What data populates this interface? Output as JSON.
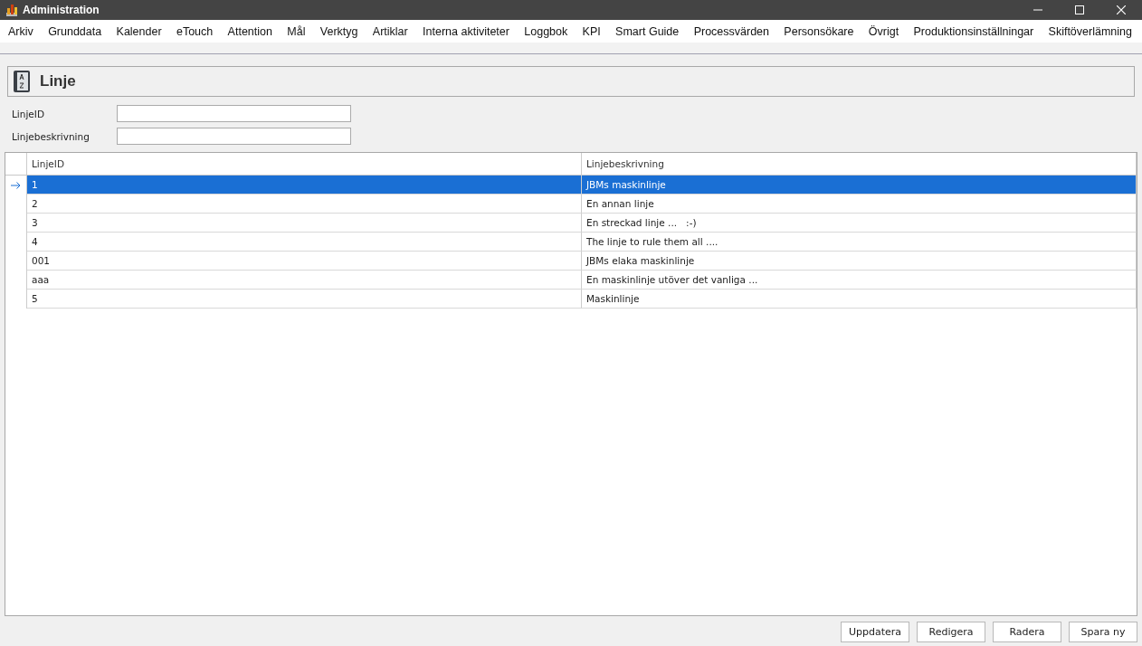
{
  "window": {
    "title": "Administration"
  },
  "menu": [
    "Arkiv",
    "Grunddata",
    "Kalender",
    "eTouch",
    "Attention",
    "Mål",
    "Verktyg",
    "Artiklar",
    "Interna aktiviteter",
    "Loggbok",
    "KPI",
    "Smart Guide",
    "Processvärden",
    "Personsökare",
    "Övrigt",
    "Produktionsinställningar",
    "Skiftöverlämning"
  ],
  "header": {
    "title": "Linje"
  },
  "filters": [
    {
      "label": "LinjeID"
    },
    {
      "label": "Linjebeskrivning"
    }
  ],
  "table": {
    "columns": [
      "LinjeID",
      "Linjebeskrivning"
    ],
    "rows": [
      {
        "cells": [
          "1",
          "JBMs maskinlinje"
        ],
        "selected": true
      },
      {
        "cells": [
          "2",
          "En annan linje"
        ],
        "selected": false
      },
      {
        "cells": [
          "3",
          "En streckad linje ...   :-)"
        ],
        "selected": false
      },
      {
        "cells": [
          "4",
          "The linje to rule them all ...."
        ],
        "selected": false
      },
      {
        "cells": [
          "001",
          "JBMs elaka maskinlinje"
        ],
        "selected": false
      },
      {
        "cells": [
          "aaa",
          "En maskinlinje utöver det vanliga ..."
        ],
        "selected": false
      },
      {
        "cells": [
          "5",
          "Maskinlinje"
        ],
        "selected": false
      }
    ]
  },
  "buttons": [
    "Uppdatera",
    "Redigera",
    "Radera",
    "Spara ny"
  ]
}
